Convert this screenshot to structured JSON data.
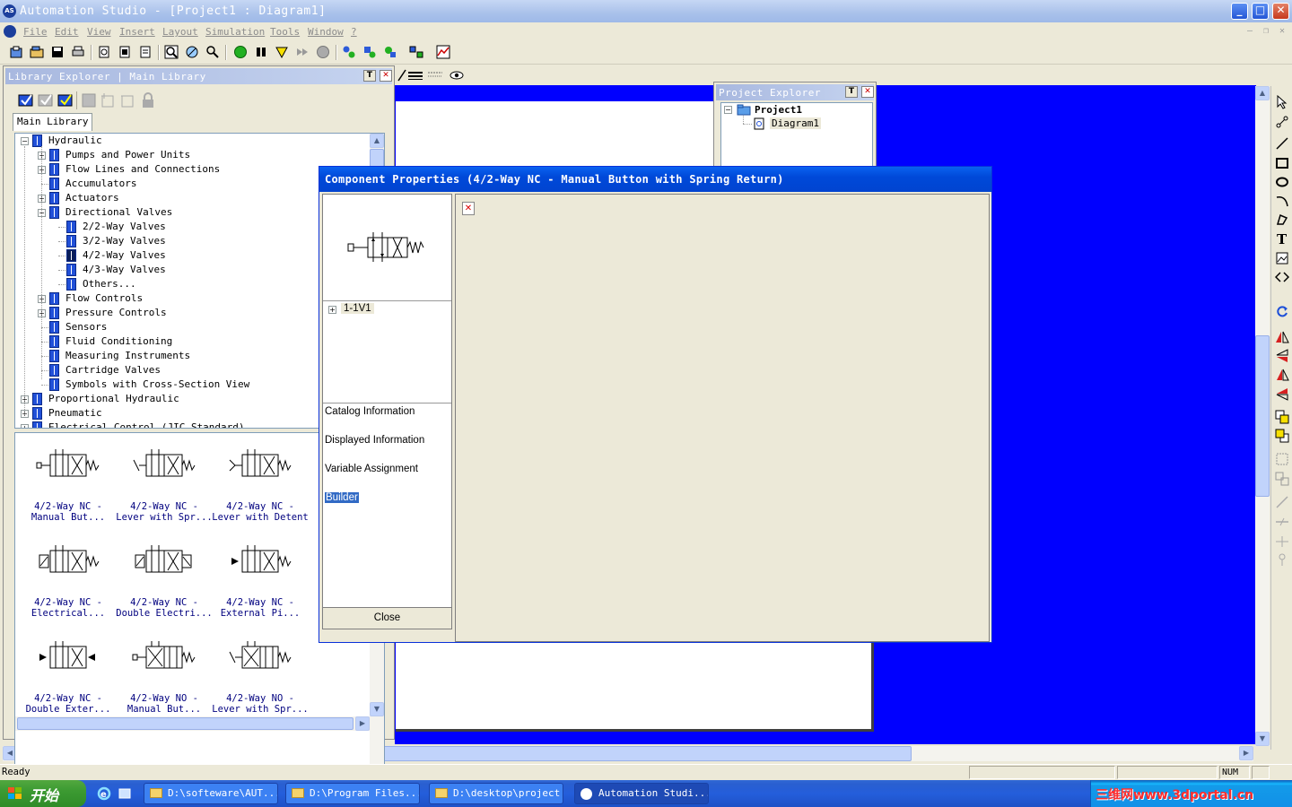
{
  "window": {
    "title": "Automation Studio - [Project1 : Diagram1]",
    "logo": "AS"
  },
  "menu": [
    "File",
    "Edit",
    "View",
    "Insert",
    "Layout",
    "Simulation",
    "Tools",
    "Window",
    "?"
  ],
  "library": {
    "header": "Library Explorer | Main Library",
    "tab": "Main Library",
    "tree": [
      {
        "label": "Hydraulic",
        "level": 0,
        "expander": "-"
      },
      {
        "label": "Pumps and Power Units",
        "level": 1,
        "expander": "+"
      },
      {
        "label": "Flow Lines and Connections",
        "level": 1,
        "expander": "+"
      },
      {
        "label": "Accumulators",
        "level": 1,
        "expander": ""
      },
      {
        "label": "Actuators",
        "level": 1,
        "expander": "+"
      },
      {
        "label": "Directional Valves",
        "level": 1,
        "expander": "-"
      },
      {
        "label": "2/2-Way Valves",
        "level": 2,
        "expander": ""
      },
      {
        "label": "3/2-Way Valves",
        "level": 2,
        "expander": ""
      },
      {
        "label": "4/2-Way Valves",
        "level": 2,
        "expander": "",
        "selected": true
      },
      {
        "label": "4/3-Way Valves",
        "level": 2,
        "expander": ""
      },
      {
        "label": "Others...",
        "level": 2,
        "expander": ""
      },
      {
        "label": "Flow Controls",
        "level": 1,
        "expander": "+"
      },
      {
        "label": "Pressure Controls",
        "level": 1,
        "expander": "+"
      },
      {
        "label": "Sensors",
        "level": 1,
        "expander": ""
      },
      {
        "label": "Fluid Conditioning",
        "level": 1,
        "expander": ""
      },
      {
        "label": "Measuring Instruments",
        "level": 1,
        "expander": ""
      },
      {
        "label": "Cartridge Valves",
        "level": 1,
        "expander": ""
      },
      {
        "label": "Symbols with Cross-Section View",
        "level": 1,
        "expander": ""
      },
      {
        "label": "Proportional Hydraulic",
        "level": 0,
        "expander": "+"
      },
      {
        "label": "Pneumatic",
        "level": 0,
        "expander": "+"
      },
      {
        "label": "Electrical Control (JIC Standard)",
        "level": 0,
        "expander": "+"
      }
    ],
    "gallery": [
      {
        "line1": "4/2-Way NC -",
        "line2": "Manual But..."
      },
      {
        "line1": "4/2-Way NC -",
        "line2": "Lever with Spr..."
      },
      {
        "line1": "4/2-Way NC -",
        "line2": "Lever with Detent"
      },
      {
        "line1": "4/2-Way NC -",
        "line2": "Electrical..."
      },
      {
        "line1": "4/2-Way NC -",
        "line2": "Double Electri..."
      },
      {
        "line1": "4/2-Way NC -",
        "line2": "External Pi..."
      },
      {
        "line1": "4/2-Way NC -",
        "line2": "Double Exter..."
      },
      {
        "line1": "4/2-Way NO -",
        "line2": "Manual But..."
      },
      {
        "line1": "4/2-Way NO -",
        "line2": "Lever with Spr..."
      }
    ]
  },
  "project": {
    "header": "Project Explorer",
    "root": "Project1",
    "child": "Diagram1"
  },
  "dialog": {
    "title": "Component Properties (4/2-Way NC - Manual Button with Spring Return)",
    "component_id": "1-1V1",
    "nav": [
      "Catalog Information",
      "Displayed Information",
      "Variable Assignment",
      "Builder"
    ],
    "selected_nav": "Builder",
    "close_label": "Close"
  },
  "status": {
    "text": "Ready",
    "num": "NUM"
  },
  "taskbar": {
    "start": "开始",
    "tasks": [
      {
        "label": "D:\\softeware\\AUT..."
      },
      {
        "label": "D:\\Program Files..."
      },
      {
        "label": "D:\\desktop\\project"
      },
      {
        "label": "Automation Studi...",
        "active": true
      }
    ],
    "watermark": "三维网www.3dportal.cn"
  }
}
